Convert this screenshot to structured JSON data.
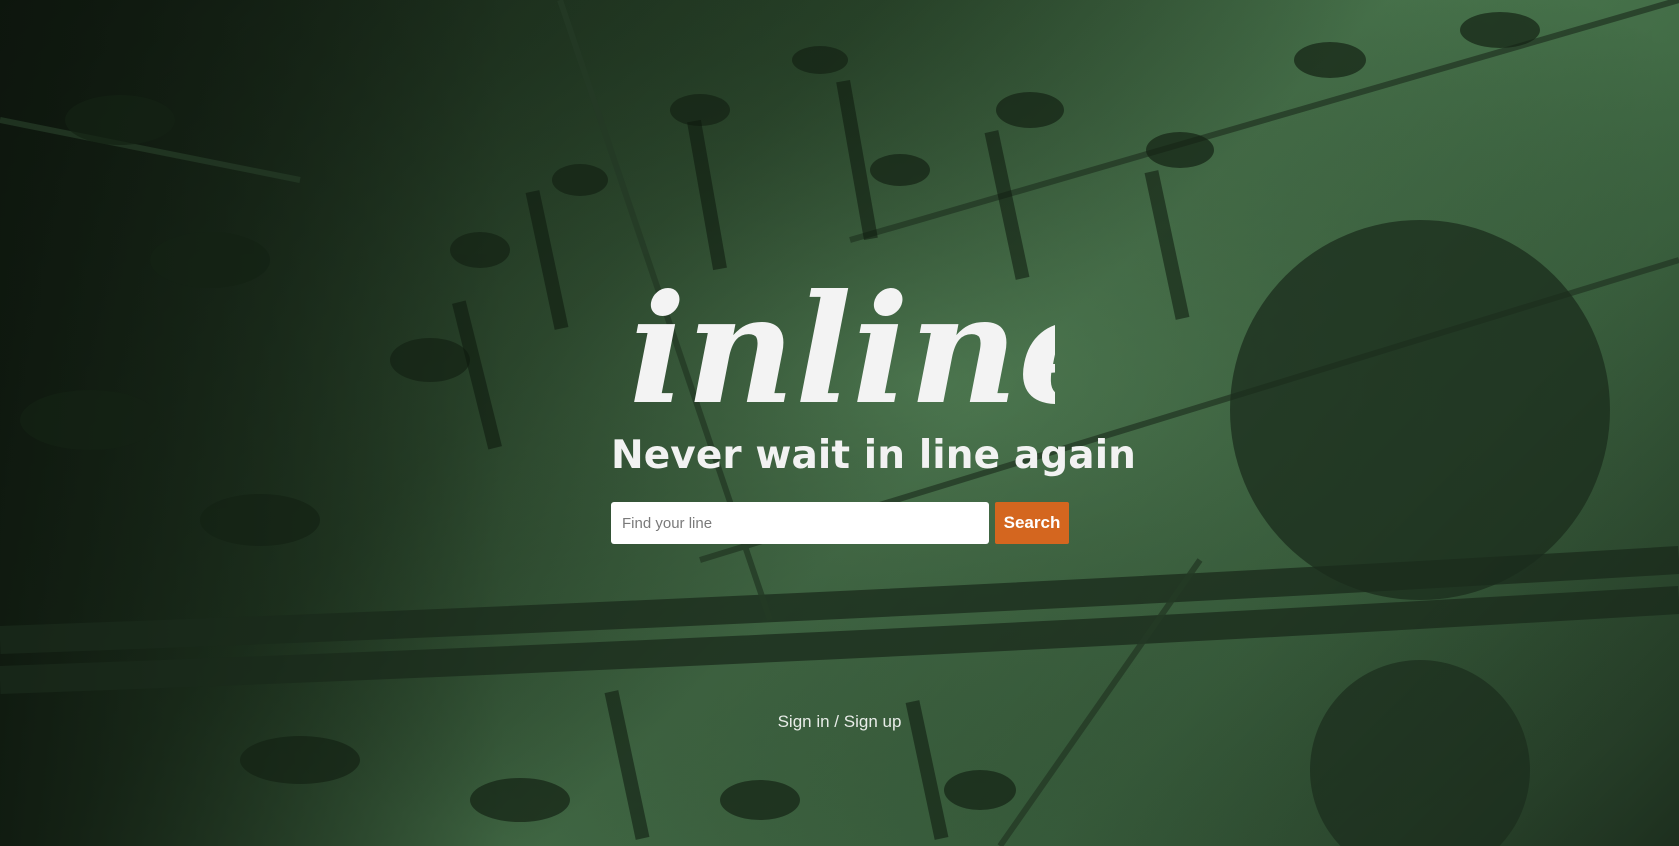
{
  "brand": {
    "logo_text": "inline"
  },
  "hero": {
    "tagline": "Never wait in line again"
  },
  "search": {
    "placeholder": "Find your line",
    "value": "",
    "button_label": "Search"
  },
  "auth": {
    "link_label": "Sign in / Sign up"
  },
  "colors": {
    "accent": "#d4661f",
    "overlay_green": "#3d6541",
    "text_light": "#f2f2f2"
  }
}
